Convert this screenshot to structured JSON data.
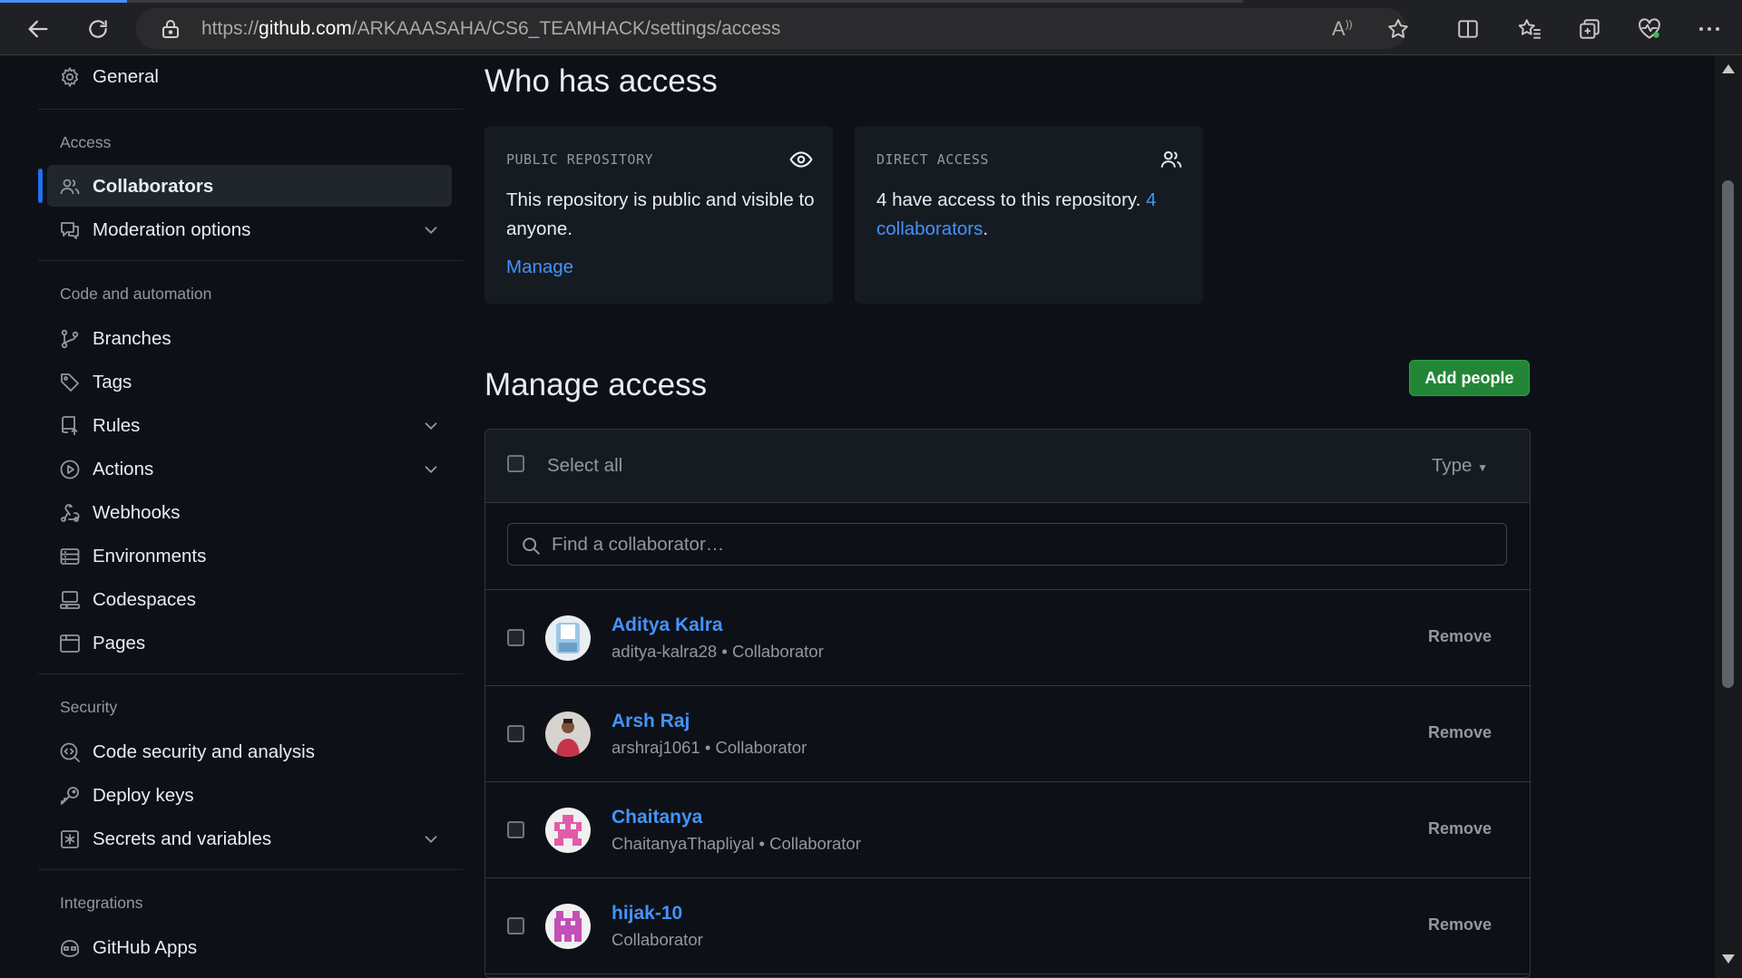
{
  "browser": {
    "url_prefix": "https://",
    "url_host": "github.com",
    "url_path": "/ARKAAASAHA/CS6_TEAMHACK/settings/access",
    "read_aloud_label": "A"
  },
  "sidebar": {
    "general": "General",
    "access_heading": "Access",
    "collaborators": "Collaborators",
    "moderation": "Moderation options",
    "code_heading": "Code and automation",
    "branches": "Branches",
    "tags": "Tags",
    "rules": "Rules",
    "actions": "Actions",
    "webhooks": "Webhooks",
    "environments": "Environments",
    "codespaces": "Codespaces",
    "pages": "Pages",
    "security_heading": "Security",
    "code_security": "Code security and analysis",
    "deploy_keys": "Deploy keys",
    "secrets": "Secrets and variables",
    "integrations_heading": "Integrations",
    "github_apps": "GitHub Apps"
  },
  "who_has_access": {
    "title": "Who has access",
    "public_card": {
      "caption": "PUBLIC REPOSITORY",
      "text": "This repository is public and visible to anyone.",
      "manage": "Manage"
    },
    "direct_card": {
      "caption": "DIRECT ACCESS",
      "text_prefix": "4 have access to this repository. ",
      "link": "4 collaborators",
      "text_suffix": "."
    }
  },
  "manage_access": {
    "title": "Manage access",
    "add_people": "Add people",
    "select_all": "Select all",
    "type_filter": "Type",
    "search_placeholder": "Find a collaborator…",
    "remove_label": "Remove",
    "collaborators": [
      {
        "name": "Aditya Kalra",
        "detail": "aditya-kalra28 • Collaborator"
      },
      {
        "name": "Arsh Raj",
        "detail": "arshraj1061 • Collaborator"
      },
      {
        "name": "Chaitanya",
        "detail": "ChaitanyaThapliyal • Collaborator"
      },
      {
        "name": "hijak-10",
        "detail": "Collaborator"
      }
    ]
  },
  "colors": {
    "accent_link": "#4493f8",
    "primary_button": "#238636",
    "active_indicator": "#1f6feb",
    "avatar_pink": "#e25ba9",
    "avatar_blue": "#9cc7e6"
  }
}
